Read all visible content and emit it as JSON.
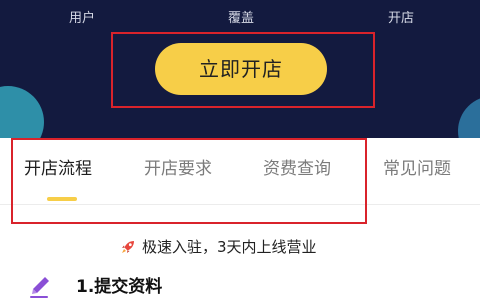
{
  "header": {
    "stats": [
      {
        "label": "用户"
      },
      {
        "label": "覆盖"
      },
      {
        "label": "开店"
      }
    ],
    "open_button_label": "立即开店"
  },
  "tabs": [
    {
      "label": "开店流程",
      "active": true
    },
    {
      "label": "开店要求",
      "active": false
    },
    {
      "label": "资费查询",
      "active": false
    },
    {
      "label": "常见问题",
      "active": false
    }
  ],
  "content": {
    "slogan_icon": "rocket-icon",
    "slogan": "极速入驻，3天内上线营业",
    "step_icon": "pen-icon",
    "step_title": "1.提交资料"
  },
  "colors": {
    "header_bg": "#131a3f",
    "accent_yellow": "#f7ce48",
    "annotation_red": "#d9232b",
    "pen_purple": "#8a4fd6"
  }
}
